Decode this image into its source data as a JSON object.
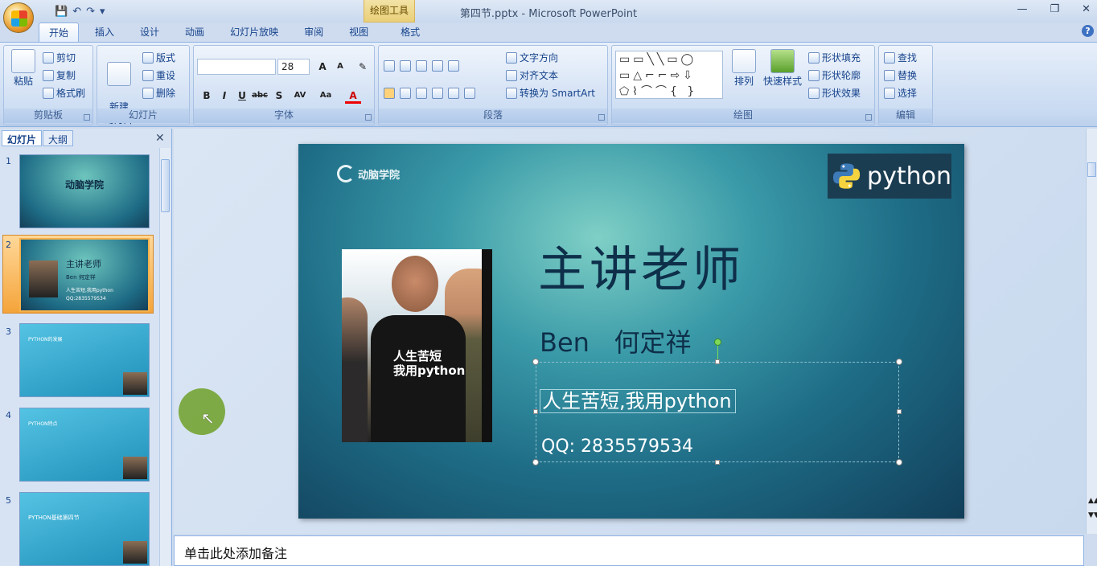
{
  "window": {
    "title": "第四节.pptx - Microsoft PowerPoint",
    "context_tab": "绘图工具"
  },
  "tabs": [
    "开始",
    "插入",
    "设计",
    "动画",
    "幻灯片放映",
    "审阅",
    "视图",
    "格式"
  ],
  "ribbon": {
    "clipboard": {
      "group": "剪贴板",
      "paste": "粘贴",
      "cut": "剪切",
      "copy": "复制",
      "format_painter": "格式刷"
    },
    "slides": {
      "group": "幻灯片",
      "new_slide": "新建\n幻灯片",
      "layout": "版式",
      "reset": "重设",
      "delete": "删除"
    },
    "font": {
      "group": "字体",
      "font_name": "",
      "font_size": "28"
    },
    "paragraph": {
      "group": "段落",
      "text_direction": "文字方向",
      "align_text": "对齐文本",
      "smartart": "转换为 SmartArt"
    },
    "drawing": {
      "group": "绘图",
      "arrange": "排列",
      "quick_styles": "快速样式",
      "fill": "形状填充",
      "outline": "形状轮廓",
      "effects": "形状效果"
    },
    "editing": {
      "group": "编辑",
      "find": "查找",
      "replace": "替换",
      "select": "选择"
    }
  },
  "panel": {
    "tab_slides": "幻灯片",
    "tab_outline": "大纲",
    "selected_index": 2,
    "thumbs": [
      {
        "num": "1",
        "title": "动脑学院"
      },
      {
        "num": "2",
        "title": "主讲老师",
        "line1": "Ben  何定祥",
        "line2": "人生苦短,我用python",
        "line3": "QQ:2835579534"
      },
      {
        "num": "3",
        "title": "PYTHON的发展"
      },
      {
        "num": "4",
        "title": "PYTHON特点"
      },
      {
        "num": "5",
        "title": "PYTHON基础第四节"
      }
    ]
  },
  "slide": {
    "logo": "动脑学院",
    "python_logo": "python",
    "title": "主讲老师",
    "name": "Ben   何定祥",
    "slogan": "人生苦短,我用python",
    "qq": "QQ: 2835579534",
    "photo_caption": "人生苦短\n我用python"
  },
  "notes": {
    "placeholder": "单击此处添加备注"
  }
}
